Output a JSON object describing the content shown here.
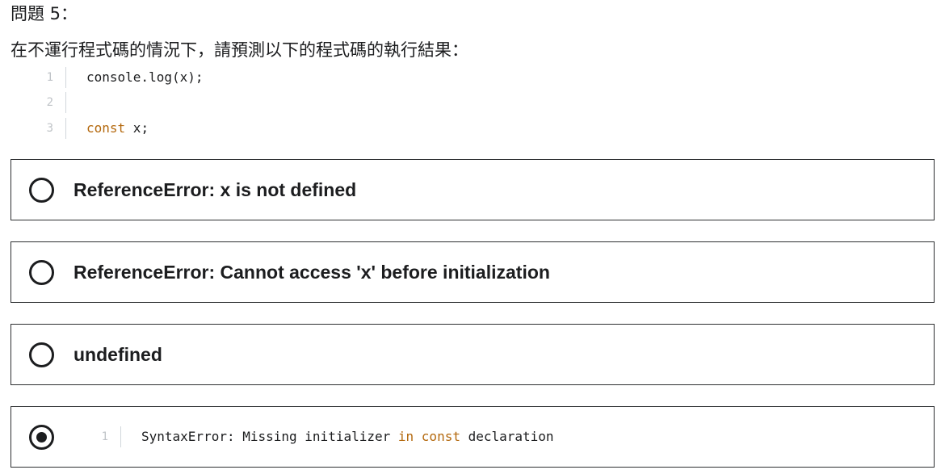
{
  "question": {
    "title": "問題 5：",
    "prompt": "在不運行程式碼的情況下，請預測以下的程式碼的執行結果：",
    "code": [
      {
        "num": "1",
        "parts": [
          {
            "text": "console.log(x);",
            "kw": false
          }
        ]
      },
      {
        "num": "2",
        "parts": []
      },
      {
        "num": "3",
        "parts": [
          {
            "text": "const",
            "kw": true
          },
          {
            "text": " x;",
            "kw": false
          }
        ]
      }
    ]
  },
  "options": [
    {
      "label": "ReferenceError: x is not defined",
      "selected": false
    },
    {
      "label": "ReferenceError: Cannot access 'x' before initialization",
      "selected": false
    },
    {
      "label": "undefined",
      "selected": false
    },
    {
      "selected": true,
      "code_num": "1",
      "code_parts": [
        {
          "text": "SyntaxError: Missing initializer ",
          "kw": false
        },
        {
          "text": "in",
          "kw": true
        },
        {
          "text": " ",
          "kw": false
        },
        {
          "text": "const",
          "kw": true
        },
        {
          "text": " declaration",
          "kw": false
        }
      ]
    }
  ],
  "colors": {
    "text": "#1c1d1f",
    "keyword": "#b4690e",
    "line_number": "#c0c4c8",
    "border": "#2d2f31"
  }
}
